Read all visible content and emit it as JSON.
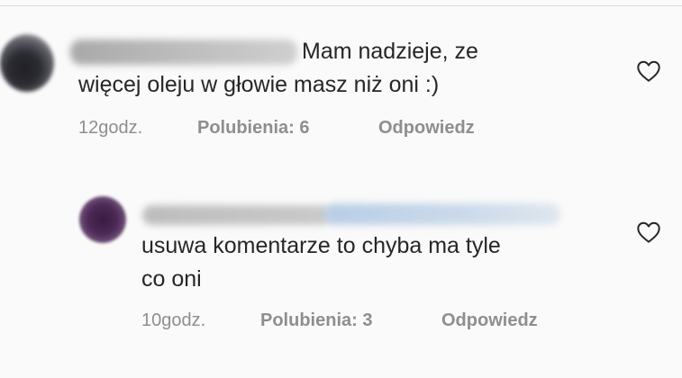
{
  "comments": [
    {
      "text_lines": [
        "Mam nadzieje, ze",
        "więcej oleju w głowie masz niż oni :)"
      ],
      "time": "12godz.",
      "likes": "Polubienia: 6",
      "reply": "Odpowiedz",
      "like_icon": "heart-outline-icon"
    },
    {
      "text_lines": [
        "usuwa komentarze to chyba ma tyle",
        "co oni"
      ],
      "time": "10godz.",
      "likes": "Polubienia: 3",
      "reply": "Odpowiedz",
      "like_icon": "heart-outline-icon"
    }
  ],
  "colors": {
    "text": "#262626",
    "meta": "#8e8e8e",
    "background": "#fafafa"
  }
}
